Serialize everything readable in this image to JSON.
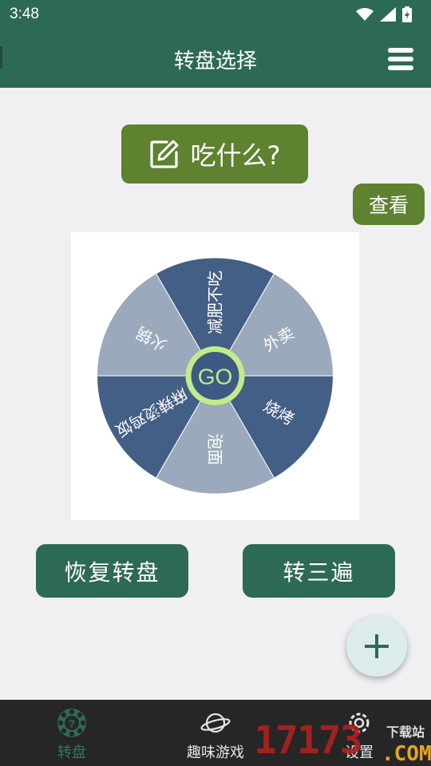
{
  "status_bar": {
    "time": "3:48"
  },
  "app_bar": {
    "title": "转盘选择"
  },
  "main_button": {
    "label": "吃什么?"
  },
  "view_button": {
    "label": "查看"
  },
  "wheel": {
    "center_label": "GO",
    "colors": {
      "light": "#9aaabc",
      "dark": "#445f85",
      "ring": "#c2eb8a",
      "center": "#3e5a84"
    },
    "segments": [
      {
        "label": "减肥不吃",
        "color": "dark"
      },
      {
        "label": "外卖",
        "color": "light"
      },
      {
        "label": "烧烤",
        "color": "dark"
      },
      {
        "label": "泡面",
        "color": "light"
      },
      {
        "label": "麻辣烫鸡饭",
        "color": "dark"
      },
      {
        "label": "火锅",
        "color": "light"
      }
    ]
  },
  "buttons": {
    "reset": "恢复转盘",
    "spin_three": "转三遍"
  },
  "fab": {
    "icon": "plus-icon"
  },
  "bottom_nav": {
    "items": [
      {
        "label": "转盘",
        "icon": "wheel-question-icon",
        "active": true
      },
      {
        "label": "趣味游戏",
        "icon": "planet-icon",
        "active": false
      },
      {
        "label": "设置",
        "icon": "gear-icon",
        "active": false
      }
    ]
  },
  "watermark": {
    "number": "17173",
    "download": "下载站",
    "domain": ".COM"
  },
  "theme": {
    "primary": "#2d6a55",
    "accent": "#5e8230",
    "background": "#f0f0f3"
  }
}
